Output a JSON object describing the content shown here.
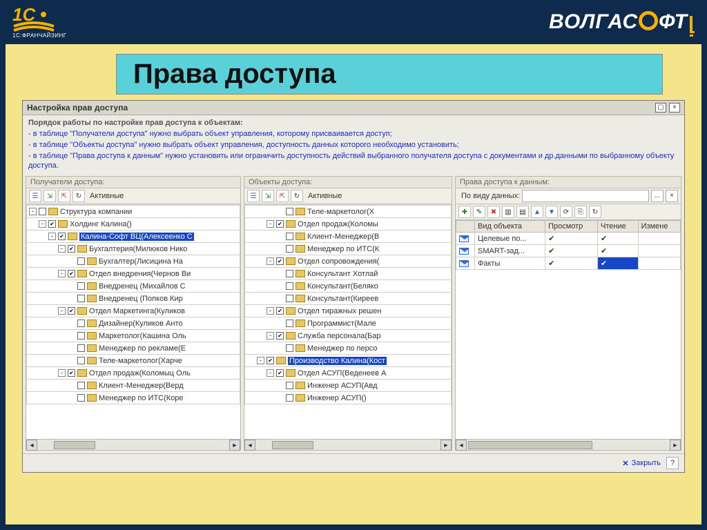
{
  "brand": {
    "company": "ВОЛГАСОФТ",
    "franchise_label": "1С:ФРАНЧАЙЗИНГ"
  },
  "slide_title": "Права доступа",
  "window": {
    "title": "Настройка прав доступа",
    "maximize_glyph": "▢",
    "close_glyph": "×"
  },
  "instructions": {
    "heading": "Порядок работы по настройке прав доступа к объектам:",
    "lines": [
      " - в таблице \"Получатели доступа\" нужно выбрать объект управления, которому присваивается доступ;",
      " - в таблице \"Объекты доступа\" нужно выбрать объект управления, доступность данных которого необходимо установить;",
      " - в таблице \"Права доступа к данным\" нужно установить или ограничить доступность действий выбранного получателя доступа с документами и др.данными по выбранному объекту доступа."
    ]
  },
  "panel_left": {
    "title": "Получатели доступа:",
    "active_label": "Активные",
    "root": "Структура компании",
    "items": [
      {
        "depth": 0,
        "exp": "-",
        "chk": false,
        "label": "Структура компании"
      },
      {
        "depth": 1,
        "exp": "-",
        "chk": true,
        "label": "Холдинг Калина()"
      },
      {
        "depth": 2,
        "exp": "-",
        "chk": true,
        "label": "Калина-Софт ВЦ(Алексеенко С",
        "hl": true
      },
      {
        "depth": 3,
        "exp": "-",
        "chk": true,
        "label": "Бухгалтерия(Милюков Нико"
      },
      {
        "depth": 4,
        "exp": "",
        "chk": false,
        "label": "Бухгалтер(Лисицина На"
      },
      {
        "depth": 3,
        "exp": "-",
        "chk": true,
        "label": "Отдел внедрения(Чернов Ви"
      },
      {
        "depth": 4,
        "exp": "",
        "chk": false,
        "label": "Внедренец (Михайлов С"
      },
      {
        "depth": 4,
        "exp": "",
        "chk": false,
        "label": "Внедренец (Попков Кир"
      },
      {
        "depth": 3,
        "exp": "-",
        "chk": true,
        "label": "Отдел Маркетинга(Куликов"
      },
      {
        "depth": 4,
        "exp": "",
        "chk": false,
        "label": "Дизайнер(Куликов Анто"
      },
      {
        "depth": 4,
        "exp": "",
        "chk": false,
        "label": "Маркетолог(Кашина Оль"
      },
      {
        "depth": 4,
        "exp": "",
        "chk": false,
        "label": "Менеджер по рекламе(Е"
      },
      {
        "depth": 4,
        "exp": "",
        "chk": false,
        "label": "Теле-маркетолог(Харче"
      },
      {
        "depth": 3,
        "exp": "-",
        "chk": true,
        "label": "Отдел продаж(Коломыц Оль"
      },
      {
        "depth": 4,
        "exp": "",
        "chk": false,
        "label": "Клиент-Менеджер(Верд"
      },
      {
        "depth": 4,
        "exp": "",
        "chk": false,
        "label": "Менеджер по ИТС(Коре"
      }
    ]
  },
  "panel_mid": {
    "title": "Объекты доступа:",
    "active_label": "Активные",
    "items": [
      {
        "depth": 3,
        "exp": "",
        "chk": false,
        "label": "Теле-маркетолог(Х"
      },
      {
        "depth": 2,
        "exp": "-",
        "chk": true,
        "label": "Отдел продаж(Коломы"
      },
      {
        "depth": 3,
        "exp": "",
        "chk": false,
        "label": "Клиент-Менеджер(В"
      },
      {
        "depth": 3,
        "exp": "",
        "chk": false,
        "label": "Менеджер по ИТС(К"
      },
      {
        "depth": 2,
        "exp": "-",
        "chk": true,
        "label": "Отдел сопровождения("
      },
      {
        "depth": 3,
        "exp": "",
        "chk": false,
        "label": "Консультант Хотлай"
      },
      {
        "depth": 3,
        "exp": "",
        "chk": false,
        "label": "Консультант(Беляко"
      },
      {
        "depth": 3,
        "exp": "",
        "chk": false,
        "label": "Консультант(Киреев"
      },
      {
        "depth": 2,
        "exp": "-",
        "chk": true,
        "label": "Отдел тиражных решен"
      },
      {
        "depth": 3,
        "exp": "",
        "chk": false,
        "label": "Программист(Мале"
      },
      {
        "depth": 2,
        "exp": "-",
        "chk": true,
        "label": "Служба персонала(Бар"
      },
      {
        "depth": 3,
        "exp": "",
        "chk": false,
        "label": "Менеджер по персо"
      },
      {
        "depth": 1,
        "exp": "-",
        "chk": true,
        "label": "Производство Калина(Кост",
        "hl": true
      },
      {
        "depth": 2,
        "exp": "-",
        "chk": true,
        "label": "Отдел АСУП(Веденеев А"
      },
      {
        "depth": 3,
        "exp": "",
        "chk": false,
        "label": "Инженер АСУП(Авд"
      },
      {
        "depth": 3,
        "exp": "",
        "chk": false,
        "label": "Инженер АСУП()"
      }
    ]
  },
  "panel_right": {
    "title": "Права доступа к данным:",
    "filter_label": "По виду данных:",
    "dots": "...",
    "x": "×",
    "columns": [
      "Вид объекта",
      "Просмотр",
      "Чтение",
      "Измене"
    ],
    "rows": [
      {
        "name": "Целевые по...",
        "view": true,
        "read": true,
        "edit": false,
        "sel": ""
      },
      {
        "name": "SMART-зад...",
        "view": true,
        "read": true,
        "edit": false,
        "sel": ""
      },
      {
        "name": "Факты",
        "view": true,
        "read": true,
        "edit": false,
        "sel": "read"
      }
    ]
  },
  "footer": {
    "close": "Закрыть",
    "help": "?"
  }
}
